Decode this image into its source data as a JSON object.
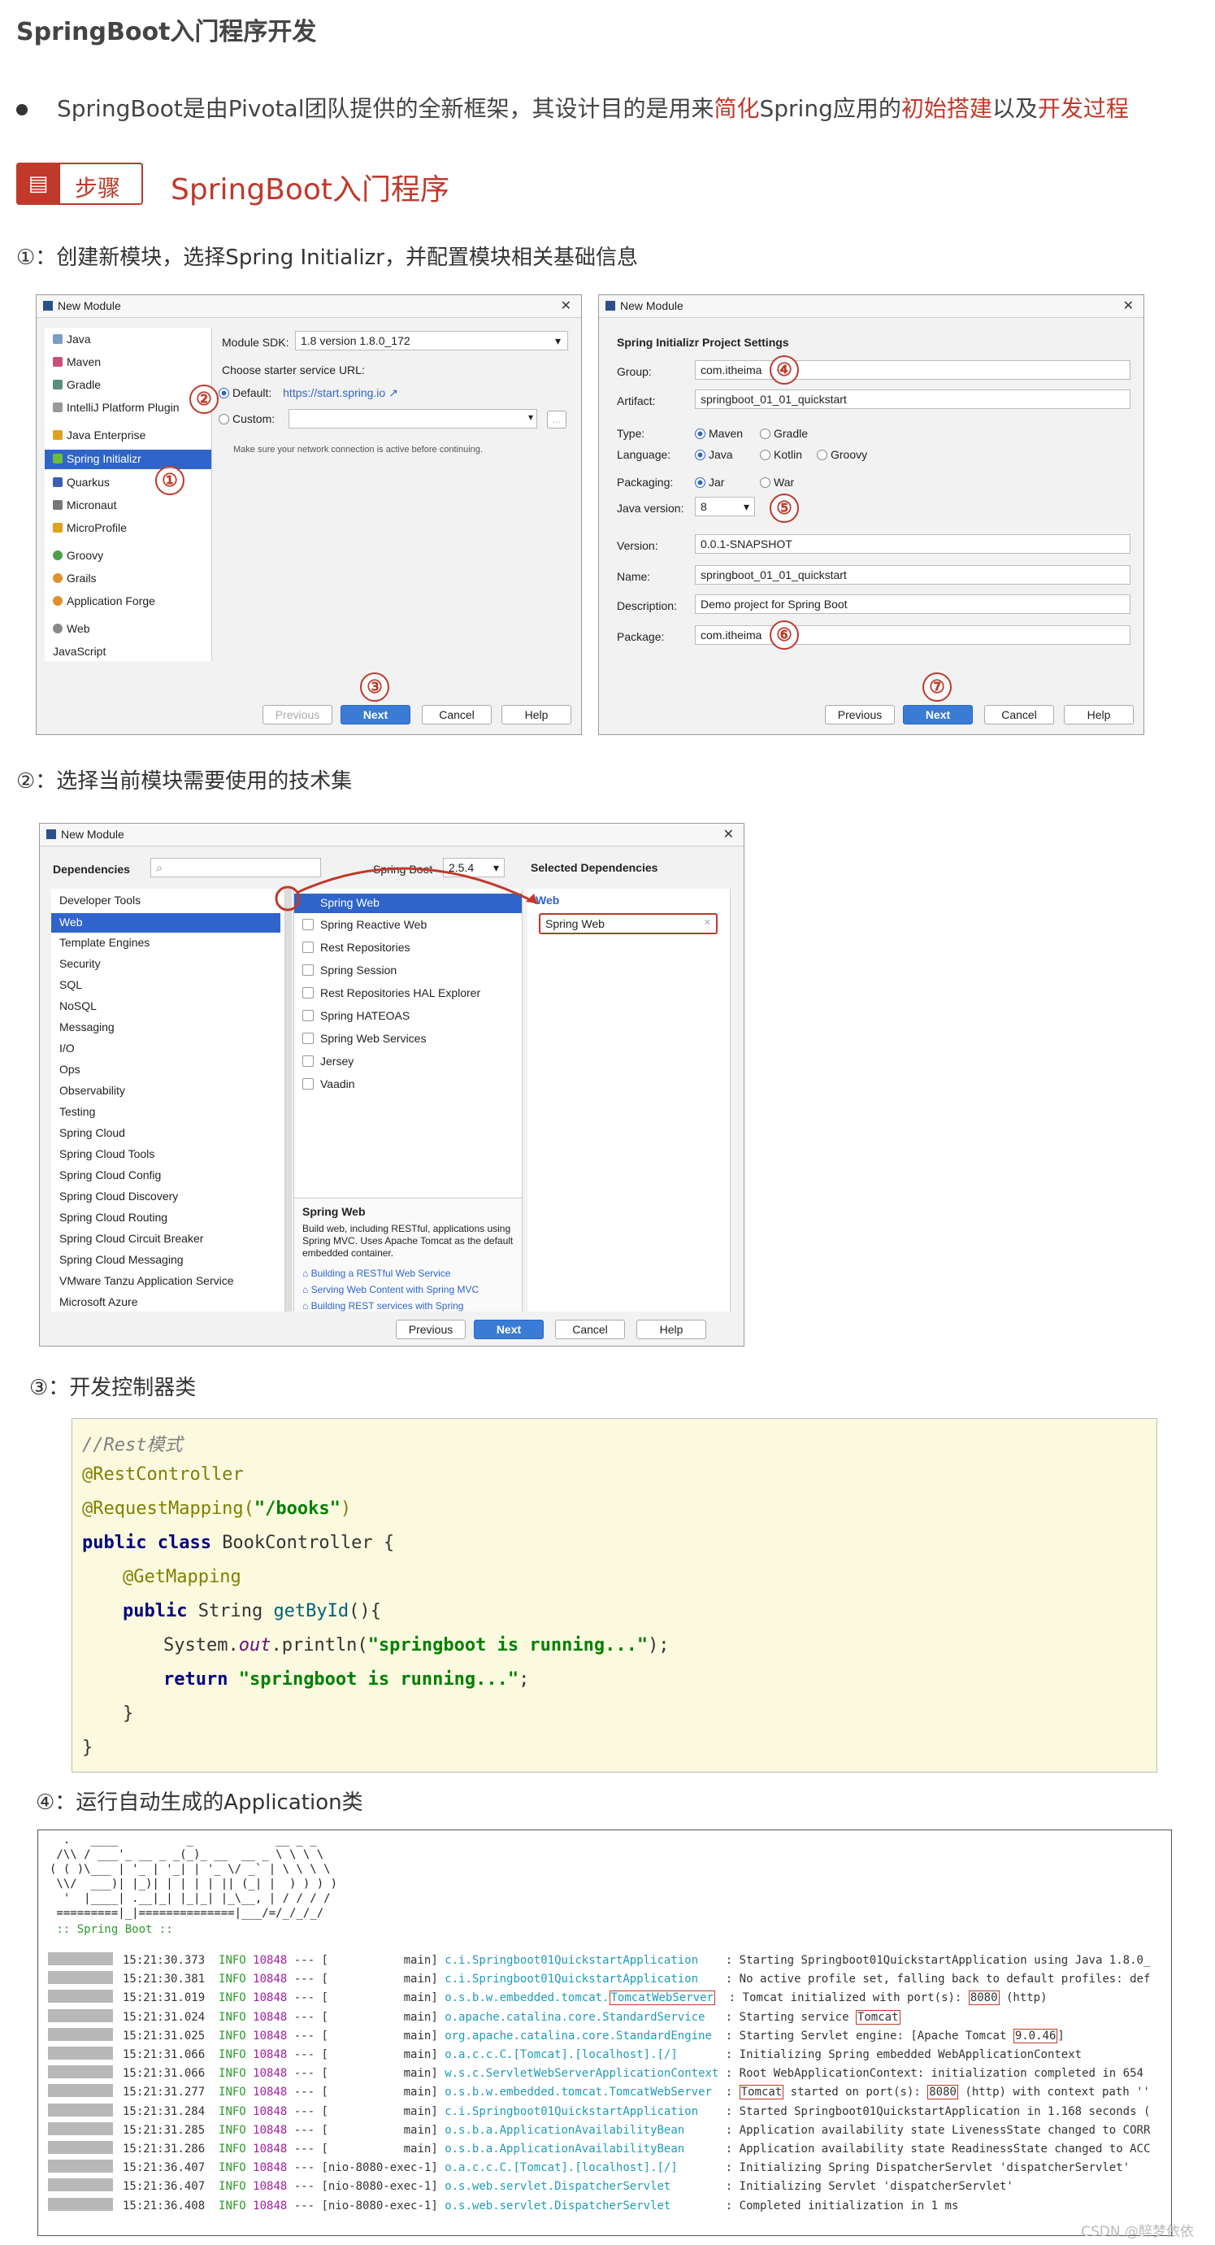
{
  "page_title": "SpringBoot入门程序开发",
  "intro": {
    "prefix": "SpringBoot是由Pivotal团队提供的全新框架，其设计目的是用来",
    "em1": "简化",
    "mid1": "Spring应用的",
    "em2": "初始搭建",
    "mid2": "以及",
    "em3": "开发过程"
  },
  "step_badge": "步骤",
  "step_title": "SpringBoot入门程序",
  "sections": {
    "s1": "①：创建新模块，选择Spring Initializr，并配置模块相关基础信息",
    "s2": "②：选择当前模块需要使用的技术集",
    "s3": "③：开发控制器类",
    "s4": "④：运行自动生成的Application类"
  },
  "dialog1": {
    "title": "New Module",
    "types": [
      "Java",
      "Maven",
      "Gradle",
      "IntelliJ Platform Plugin",
      "Java Enterprise",
      "Spring Initializr",
      "Quarkus",
      "Micronaut",
      "MicroProfile",
      "Groovy",
      "Grails",
      "Application Forge",
      "Web",
      "JavaScript"
    ],
    "sdk_label": "Module SDK:",
    "sdk_value": "1.8 version 1.8.0_172",
    "url_label": "Choose starter service URL:",
    "default_label": "Default:",
    "default_url": "https://start.spring.io ↗",
    "custom_label": "Custom:",
    "hint": "Make sure your network connection is active before continuing.",
    "buttons": {
      "previous": "Previous",
      "next": "Next",
      "cancel": "Cancel",
      "help": "Help"
    }
  },
  "dialog2": {
    "title": "New Module",
    "heading": "Spring Initializr Project Settings",
    "group_label": "Group:",
    "group": "com.itheima",
    "artifact_label": "Artifact:",
    "artifact": "springboot_01_01_quickstart",
    "type_label": "Type:",
    "type_opts": [
      "Maven",
      "Gradle"
    ],
    "lang_label": "Language:",
    "lang_opts": [
      "Java",
      "Kotlin",
      "Groovy"
    ],
    "pack_label": "Packaging:",
    "pack_opts": [
      "Jar",
      "War"
    ],
    "jv_label": "Java version:",
    "jv": "8",
    "version_label": "Version:",
    "version": "0.0.1-SNAPSHOT",
    "name_label": "Name:",
    "name": "springboot_01_01_quickstart",
    "desc_label": "Description:",
    "desc": "Demo project for Spring Boot",
    "pkg_label": "Package:",
    "pkg": "com.itheima",
    "buttons": {
      "previous": "Previous",
      "next": "Next",
      "cancel": "Cancel",
      "help": "Help"
    }
  },
  "dialog3": {
    "title": "New Module",
    "deps_label": "Dependencies",
    "sb_label": "Spring Boot",
    "sb_version": "2.5.4",
    "selected_label": "Selected Dependencies",
    "categories": [
      "Developer Tools",
      "Web",
      "Template Engines",
      "Security",
      "SQL",
      "NoSQL",
      "Messaging",
      "I/O",
      "Ops",
      "Observability",
      "Testing",
      "Spring Cloud",
      "Spring Cloud Tools",
      "Spring Cloud Config",
      "Spring Cloud Discovery",
      "Spring Cloud Routing",
      "Spring Cloud Circuit Breaker",
      "Spring Cloud Messaging",
      "VMware Tanzu Application Service",
      "Microsoft Azure"
    ],
    "deps": [
      "Spring Web",
      "Spring Reactive Web",
      "Rest Repositories",
      "Spring Session",
      "Rest Repositories HAL Explorer",
      "Spring HATEOAS",
      "Spring Web Services",
      "Jersey",
      "Vaadin"
    ],
    "sel_group": "Web",
    "sel_item": "Spring Web",
    "desc_title": "Spring Web",
    "desc_text": "Build web, including RESTful, applications using Spring MVC. Uses Apache Tomcat as the default embedded container.",
    "links": [
      "Building a RESTful Web Service",
      "Serving Web Content with Spring MVC",
      "Building REST services with Spring"
    ],
    "buttons": {
      "previous": "Previous",
      "next": "Next",
      "cancel": "Cancel",
      "help": "Help"
    }
  },
  "code": {
    "l1": "//Rest模式",
    "l2": "@RestController",
    "l3a": "@RequestMapping(",
    "l3b": "\"/books\"",
    "l3c": ")",
    "l4a": "public class ",
    "l4b": "BookController {",
    "l5": "@GetMapping",
    "l6a": "public ",
    "l6b": "String ",
    "l6c": "getById",
    "l6d": "(){",
    "l7a": "System.",
    "l7b": "out",
    "l7c": ".println(",
    "l7d": "\"springboot is running...\"",
    "l7e": ");",
    "l8a": "return ",
    "l8b": "\"springboot is running...\"",
    "l8c": ";",
    "l9": "}",
    "l10": "}"
  },
  "console": {
    "banner": [
      "  .   ____          _            __ _ _",
      " /\\\\ / ___'_ __ _ _(_)_ __  __ _ \\ \\ \\ \\",
      "( ( )\\___ | '_ | '_| | '_ \\/ _` | \\ \\ \\ \\",
      " \\\\/  ___)| |_)| | | | | || (_| |  ) ) ) )",
      "  '  |____| .__|_| |_|_| |_\\__, | / / / /",
      " =========|_|==============|___/=/_/_/_/"
    ],
    "boot_label": " :: Spring Boot ::",
    "logs": [
      {
        "t": "15:21:30.373",
        "lv": "INFO",
        "pid": "10848",
        "th": "[           main]",
        "c": "c.i.Springboot01QuickstartApplication",
        "m": ": Starting Springboot01QuickstartApplication using Java 1.8.0_"
      },
      {
        "t": "15:21:30.381",
        "lv": "INFO",
        "pid": "10848",
        "th": "[           main]",
        "c": "c.i.Springboot01QuickstartApplication",
        "m": ": No active profile set, falling back to default profiles: def"
      },
      {
        "t": "15:21:31.019",
        "lv": "INFO",
        "pid": "10848",
        "th": "[           main]",
        "c": "o.s.b.w.embedded.tomcat.",
        "ch": "TomcatWebServer",
        "m": ": Tomcat initialized with port(s): ",
        "mh": "8080",
        "mt": " (http)"
      },
      {
        "t": "15:21:31.024",
        "lv": "INFO",
        "pid": "10848",
        "th": "[           main]",
        "c": "o.apache.catalina.core.StandardService",
        "m": ": Starting service ",
        "mh": "Tomcat",
        "mt": ""
      },
      {
        "t": "15:21:31.025",
        "lv": "INFO",
        "pid": "10848",
        "th": "[           main]",
        "c": "org.apache.catalina.core.StandardEngine",
        "m": ": Starting Servlet engine: [Apache Tomcat ",
        "mh": "9.0.46",
        "mt": "]"
      },
      {
        "t": "15:21:31.066",
        "lv": "INFO",
        "pid": "10848",
        "th": "[           main]",
        "c": "o.a.c.c.C.[Tomcat].[localhost].[/]",
        "m": ": Initializing Spring embedded WebApplicationContext"
      },
      {
        "t": "15:21:31.066",
        "lv": "INFO",
        "pid": "10848",
        "th": "[           main]",
        "c": "w.s.c.ServletWebServerApplicationContext",
        "m": ": Root WebApplicationContext: initialization completed in 654"
      },
      {
        "t": "15:21:31.277",
        "lv": "INFO",
        "pid": "10848",
        "th": "[           main]",
        "c": "o.s.b.w.embedded.tomcat.TomcatWebServer",
        "m": ": ",
        "mh": "Tomcat",
        "mt": " started on port(s): ",
        "mh2": "8080",
        "mt2": " (http) with context path ''"
      },
      {
        "t": "15:21:31.284",
        "lv": "INFO",
        "pid": "10848",
        "th": "[           main]",
        "c": "c.i.Springboot01QuickstartApplication",
        "m": ": Started Springboot01QuickstartApplication in 1.168 seconds ("
      },
      {
        "t": "15:21:31.285",
        "lv": "INFO",
        "pid": "10848",
        "th": "[           main]",
        "c": "o.s.b.a.ApplicationAvailabilityBean",
        "m": ": Application availability state LivenessState changed to CORR"
      },
      {
        "t": "15:21:31.286",
        "lv": "INFO",
        "pid": "10848",
        "th": "[           main]",
        "c": "o.s.b.a.ApplicationAvailabilityBean",
        "m": ": Application availability state ReadinessState changed to ACC"
      },
      {
        "t": "15:21:36.407",
        "lv": "INFO",
        "pid": "10848",
        "th": "[nio-8080-exec-1]",
        "c": "o.a.c.c.C.[Tomcat].[localhost].[/]",
        "m": ": Initializing Spring DispatcherServlet 'dispatcherServlet'"
      },
      {
        "t": "15:21:36.407",
        "lv": "INFO",
        "pid": "10848",
        "th": "[nio-8080-exec-1]",
        "c": "o.s.web.servlet.DispatcherServlet",
        "m": ": Initializing Servlet 'dispatcherServlet'"
      },
      {
        "t": "15:21:36.408",
        "lv": "INFO",
        "pid": "10848",
        "th": "[nio-8080-exec-1]",
        "c": "o.s.web.servlet.DispatcherServlet",
        "m": ": Completed initialization in 1 ms"
      }
    ]
  },
  "markers": [
    "①",
    "②",
    "③",
    "④",
    "⑤",
    "⑥",
    "⑦"
  ],
  "watermark": "CSDN @醉梦依依",
  "colors": {
    "accent_red": "#c0392b",
    "ide_blue": "#2f65ca",
    "code_bg": "#fbfadf"
  }
}
